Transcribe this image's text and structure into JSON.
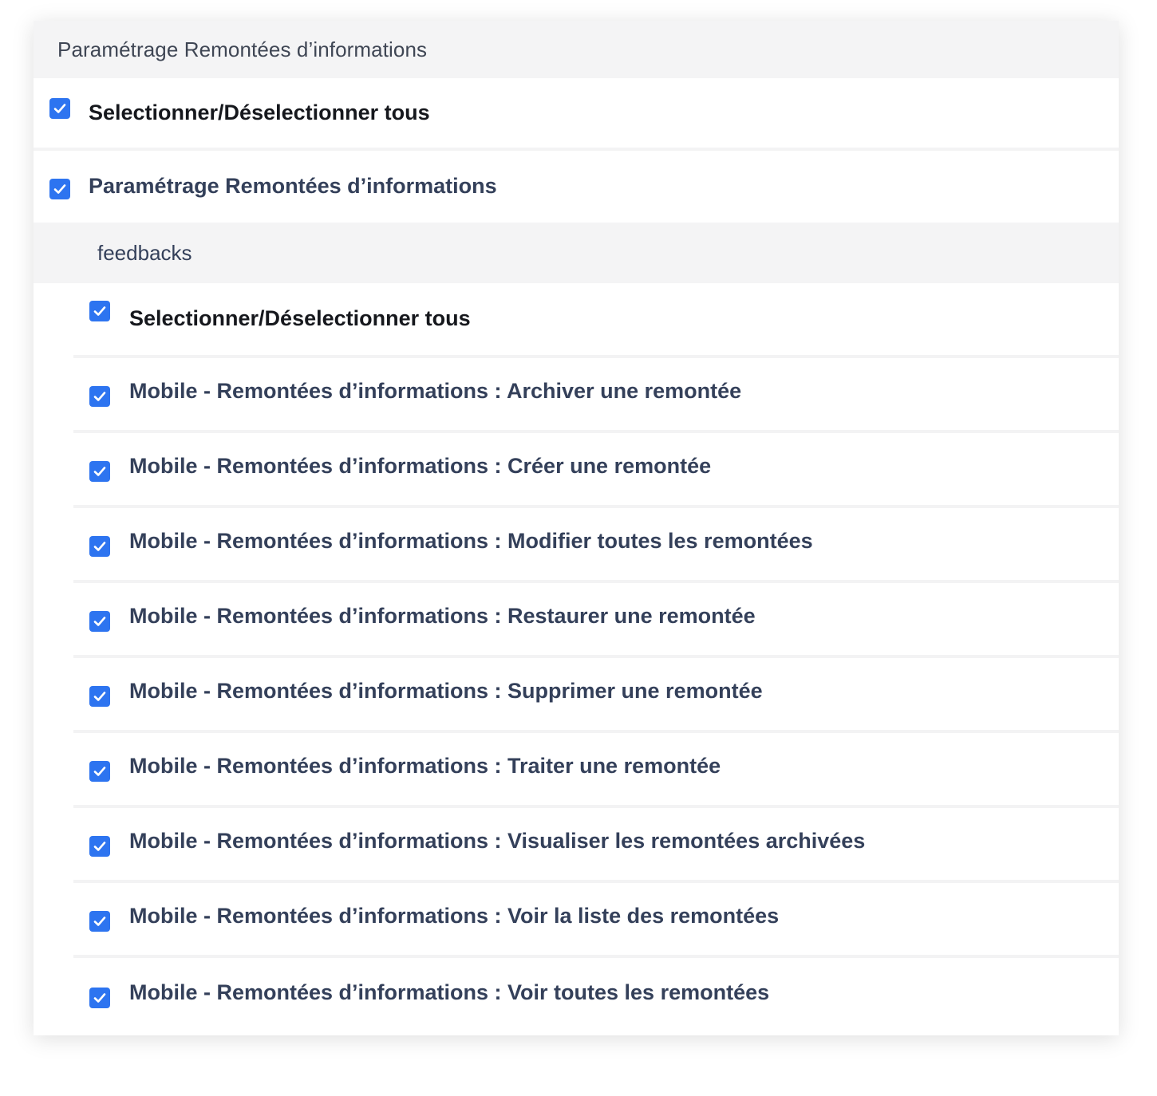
{
  "header": {
    "title": "Paramétrage Remontées d’informations"
  },
  "select_all_top": {
    "label": "Selectionner/Déselectionner tous",
    "checked": true
  },
  "group": {
    "label": "Paramétrage Remontées d’informations",
    "checked": true
  },
  "section": {
    "title": "feedbacks",
    "select_all": {
      "label": "Selectionner/Déselectionner tous",
      "checked": true
    },
    "items": [
      {
        "label": "Mobile - Remontées d’informations : Archiver une remontée",
        "checked": true
      },
      {
        "label": "Mobile - Remontées d’informations : Créer une remontée",
        "checked": true
      },
      {
        "label": "Mobile - Remontées d’informations : Modifier toutes les remontées",
        "checked": true
      },
      {
        "label": "Mobile - Remontées d’informations : Restaurer une remontée",
        "checked": true
      },
      {
        "label": "Mobile - Remontées d’informations : Supprimer une remontée",
        "checked": true
      },
      {
        "label": "Mobile - Remontées d’informations : Traiter une remontée",
        "checked": true
      },
      {
        "label": "Mobile - Remontées d’informations : Visualiser les remontées archivées",
        "checked": true
      },
      {
        "label": "Mobile - Remontées d’informations : Voir la liste des remontées",
        "checked": true
      },
      {
        "label": "Mobile - Remontées d’informations : Voir toutes les remontées",
        "checked": true
      }
    ]
  },
  "colors": {
    "checkbox": "#2d74f0",
    "header_bg": "#f4f4f5",
    "label_text": "#34405a"
  },
  "icons": {
    "checkbox": "check-icon"
  }
}
